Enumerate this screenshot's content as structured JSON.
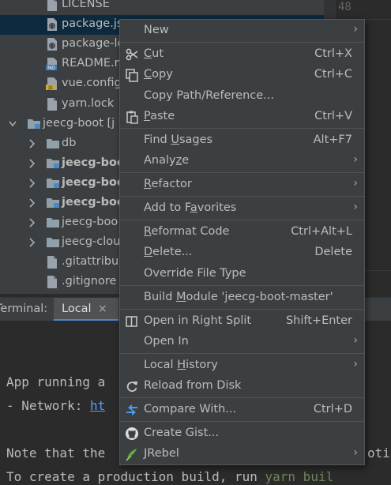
{
  "tree": {
    "rows": [
      {
        "label": "LICENSE",
        "type": "file",
        "indent": 1
      },
      {
        "label": "package.js",
        "type": "json",
        "indent": 1,
        "selected": true
      },
      {
        "label": "package-lo",
        "type": "json",
        "indent": 1
      },
      {
        "label": "README.m",
        "type": "md",
        "indent": 1
      },
      {
        "label": "vue.config",
        "type": "js",
        "indent": 1
      },
      {
        "label": "yarn.lock",
        "type": "file",
        "indent": 1
      },
      {
        "label": "jeecg-boot [j",
        "type": "module",
        "indent": 0,
        "expanded": true
      },
      {
        "label": "db",
        "type": "folder",
        "indent": 1,
        "collapsed": true
      },
      {
        "label": "jeecg-boo",
        "type": "module",
        "indent": 1,
        "collapsed": true,
        "bold": true
      },
      {
        "label": "jeecg-boo",
        "type": "module",
        "indent": 1,
        "collapsed": true,
        "bold": true
      },
      {
        "label": "jeecg-boo",
        "type": "module",
        "indent": 1,
        "collapsed": true,
        "bold": true
      },
      {
        "label": "jeecg-boo",
        "type": "folder",
        "indent": 1,
        "collapsed": true
      },
      {
        "label": "jeecg-clou",
        "type": "folder",
        "indent": 1,
        "collapsed": true
      },
      {
        "label": ".gitattribu",
        "type": "file",
        "indent": 1
      },
      {
        "label": ".gitignore",
        "type": "file",
        "indent": 1
      }
    ]
  },
  "editor": {
    "line_number": "48"
  },
  "terminal": {
    "title": "Terminal:",
    "tab_label": "Local",
    "tab_close": "×",
    "line1": "App running a",
    "line2_prefix": "- Network: ",
    "line2_link": "ht",
    "line3": "Note that the",
    "line3_tail": "otin",
    "line4_prefix": "To create a production build, run ",
    "line4_cmd": "yarn buil"
  },
  "menu": {
    "new": {
      "label": "New"
    },
    "cut": {
      "pre": "",
      "u": "C",
      "post": "ut",
      "shortcut": "Ctrl+X"
    },
    "copy": {
      "pre": "",
      "u": "C",
      "post": "opy",
      "shortcut": "Ctrl+C"
    },
    "copy_path": {
      "label": "Copy Path/Reference..."
    },
    "paste": {
      "pre": "",
      "u": "P",
      "post": "aste",
      "shortcut": "Ctrl+V"
    },
    "find_usages": {
      "pre": "Find ",
      "u": "U",
      "post": "sages",
      "shortcut": "Alt+F7"
    },
    "analyze": {
      "pre": "Analy",
      "u": "z",
      "post": "e"
    },
    "refactor": {
      "pre": "",
      "u": "R",
      "post": "efactor"
    },
    "favorites": {
      "pre": "Add to F",
      "u": "a",
      "post": "vorites"
    },
    "reformat": {
      "pre": "",
      "u": "R",
      "post": "eformat Code",
      "shortcut": "Ctrl+Alt+L"
    },
    "delete": {
      "pre": "",
      "u": "D",
      "post": "elete...",
      "shortcut": "Delete"
    },
    "override": {
      "label": "Override File Type"
    },
    "build": {
      "pre": "Build ",
      "u": "M",
      "post": "odule 'jeecg-boot-master'"
    },
    "open_right": {
      "label": "Open in Right Split",
      "shortcut": "Shift+Enter"
    },
    "open_in": {
      "label": "Open In"
    },
    "local_history": {
      "pre": "Local ",
      "u": "H",
      "post": "istory"
    },
    "reload": {
      "label": "Reload from Disk"
    },
    "compare": {
      "label": "Compare With...",
      "shortcut": "Ctrl+D"
    },
    "gist": {
      "label": "Create Gist..."
    },
    "jrebel": {
      "label": "JRebel"
    },
    "submenu_glyph": "›"
  },
  "colors": {
    "accent": "#4a88c7",
    "menu_bg": "#3c3f41",
    "selection": "#0d293e"
  }
}
